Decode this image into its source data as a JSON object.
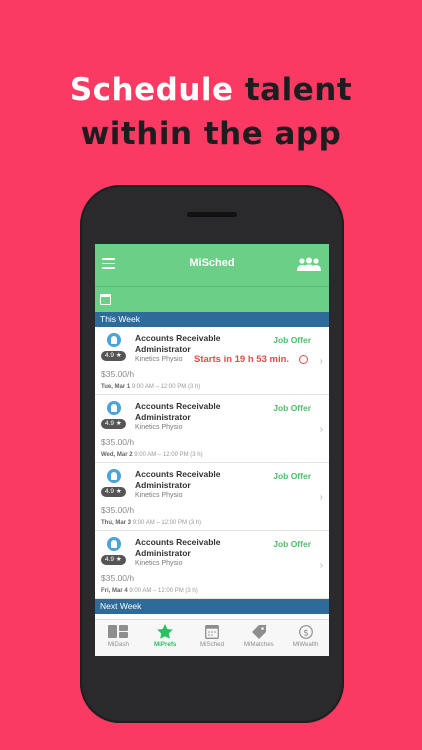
{
  "headline": {
    "line1_a": "Schedule",
    "line1_b": "talent",
    "line2": "within the app"
  },
  "app": {
    "title": "MiSched",
    "sections": {
      "this_week": "This Week",
      "next_week": "Next Week"
    },
    "cards": [
      {
        "title": "Accounts Receivable Administrator",
        "status": "Job Offer",
        "rating": "4.9 ★",
        "company": "Kinetics Physio",
        "countdown": "Starts in 19 h 53 min.",
        "price": "$35.00/h",
        "day": "Tue, Mar 1",
        "time": "9:00 AM – 12:00 PM (3 h)"
      },
      {
        "title": "Accounts Receivable Administrator",
        "status": "Job Offer",
        "rating": "4.9 ★",
        "company": "Kinetics Physio",
        "price": "$35.00/h",
        "day": "Wed, Mar 2",
        "time": "9:00 AM – 12:00 PM (3 h)"
      },
      {
        "title": "Accounts Receivable Administrator",
        "status": "Job Offer",
        "rating": "4.9 ★",
        "company": "Kinetics Physio",
        "price": "$35.00/h",
        "day": "Thu, Mar 3",
        "time": "9:00 AM – 12:00 PM (3 h)"
      },
      {
        "title": "Accounts Receivable Administrator",
        "status": "Job Offer",
        "rating": "4.9 ★",
        "company": "Kinetics Physio",
        "price": "$35.00/h",
        "day": "Fri, Mar 4",
        "time": "9:00 AM – 12:00 PM (3 h)"
      }
    ],
    "tabs": [
      {
        "label": "MiDash",
        "icon": "dashboard-icon"
      },
      {
        "label": "MiPrefs",
        "icon": "star-icon",
        "active": true
      },
      {
        "label": "MiSched",
        "icon": "calendar-icon"
      },
      {
        "label": "MiMatches",
        "icon": "tag-icon"
      },
      {
        "label": "MiWealth",
        "icon": "dollar-icon"
      }
    ]
  },
  "colors": {
    "background": "#fb3a64",
    "nav": "#6bcf87",
    "section": "#2e6b9b",
    "offer": "#4cbf6b",
    "countdown": "#e34a4a"
  }
}
